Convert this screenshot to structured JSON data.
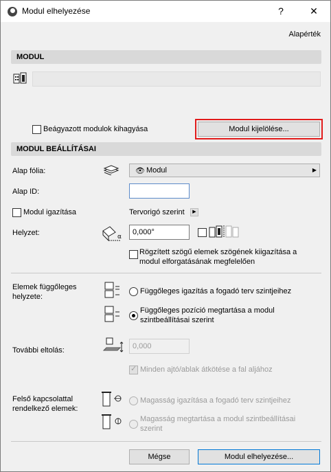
{
  "window": {
    "title": "Modul elhelyezése",
    "help_label": "?",
    "close_label": "✕"
  },
  "header": {
    "defaults_link": "Alapérték"
  },
  "module_section": {
    "title": "MODUL",
    "skip_embedded_label": "Beágyazott modulok kihagyása",
    "select_module_button": "Modul kijelölése..."
  },
  "settings_section": {
    "title": "MODUL BEÁLLÍTÁSAI",
    "base_layer_label": "Alap fólia:",
    "base_layer_value": "Modul",
    "base_id_label": "Alap ID:",
    "base_id_value": "",
    "align_module_label": "Modul igazítása",
    "align_by_value": "Tervorigó szerint",
    "position_label": "Helyzet:",
    "angle_value": "0,000°",
    "rotate_fixed_label_line1": "Rögzített szögű elemek szögének kiigazítása a",
    "rotate_fixed_label_line2": "modul elforgatásának megfelelően"
  },
  "vertical_section": {
    "label_line1": "Elemek függőleges",
    "label_line2": "helyzete:",
    "option1_label": "Függőleges igazítás a fogadó terv szintjeihez",
    "option2_line1": "Függőleges pozíció megtartása a modul",
    "option2_line2": "szintbeállításai szerint",
    "selected_option": 2
  },
  "offset_section": {
    "label": "További eltolás:",
    "offset_value": "0,000",
    "reconnect_label": "Minden ajtó/ablak átkötése a fal aljához"
  },
  "top_linked_section": {
    "label_line1": "Felső kapcsolattal",
    "label_line2": "rendelkező elemek:",
    "option1_label": "Magasság igazítása a fogadó terv szintjeihez",
    "option2_line1": "Magasság megtartása a modul szintbeállításai",
    "option2_line2": "szerint"
  },
  "footer": {
    "cancel_button": "Mégse",
    "place_button": "Modul elhelyezése..."
  }
}
